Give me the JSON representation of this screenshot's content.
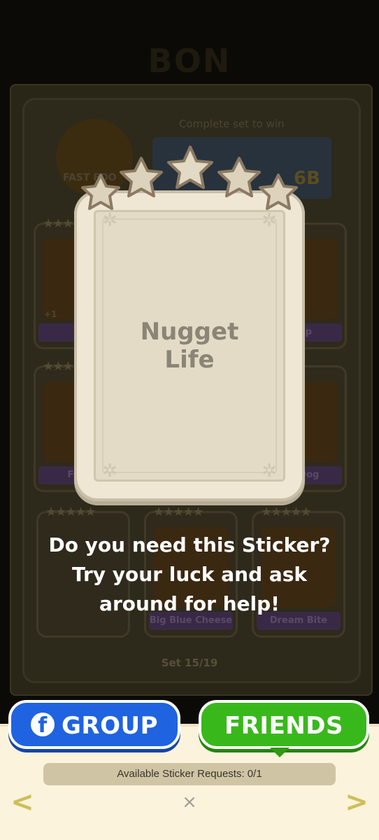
{
  "background": {
    "title": "BON",
    "complete_set_text": "Complete set to win",
    "reward_amount": "6B",
    "fastfood_label": "FAST FOO",
    "cards": [
      {
        "label": "Fr",
        "badge": "+1"
      },
      {
        "label": "Stop"
      },
      {
        "label": "Fried"
      },
      {
        "label": "rty Dog"
      },
      {
        "label": ""
      },
      {
        "label": "Big Blue Cheese"
      },
      {
        "label": "Dream Bite"
      }
    ],
    "set_label": "Set 15/19"
  },
  "sticker": {
    "name": "Nugget Life",
    "stars": 5
  },
  "prompt": {
    "line1": "Do you need this Sticker?",
    "line2": "Try your luck and ask",
    "line3": "around for help!"
  },
  "buttons": {
    "group": "GROUP",
    "friends": "FRIENDS"
  },
  "requests_text": "Available Sticker Requests: 0/1",
  "nav": {
    "prev": "<",
    "next": ">",
    "close": "×"
  },
  "colors": {
    "group_button": "#1f63e0",
    "friends_button": "#39b81c",
    "panel": "#fbf3dc",
    "sticker": "#efe7d3"
  }
}
